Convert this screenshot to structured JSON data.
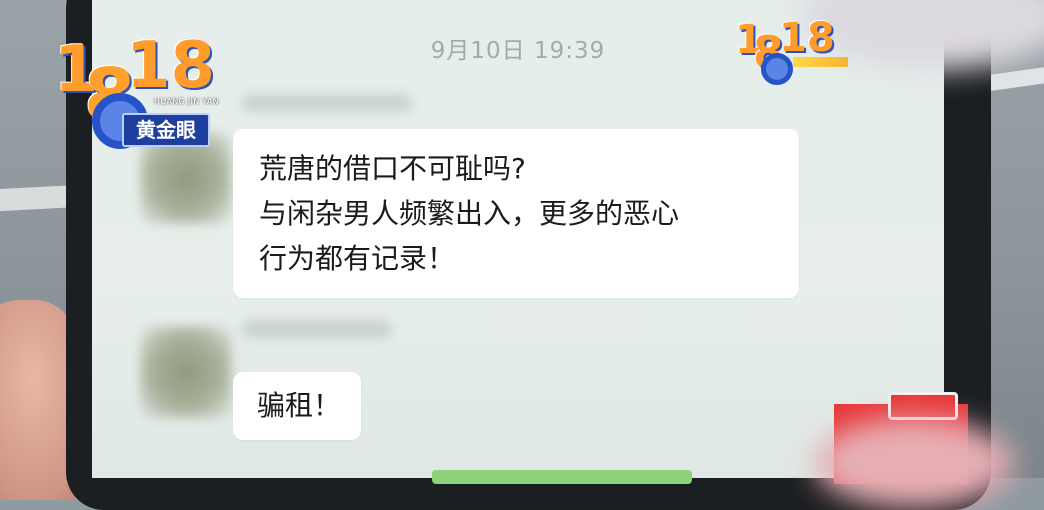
{
  "chat": {
    "timestamp": "9月10日 19:39",
    "messages": [
      {
        "lines": [
          "荒唐的借口不可耻吗?",
          "与闲杂男人频繁出入，更多的恶心",
          "行为都有记录！"
        ]
      },
      {
        "lines": [
          "骗租！"
        ]
      }
    ]
  },
  "logo": {
    "digits": "1818",
    "pinyin": "HUANG JIN YAN",
    "name": "黄金眼"
  },
  "colors": {
    "screen_bg": "#e5eeeb",
    "bubble_bg": "#ffffff",
    "timestamp": "#a4aaa7",
    "logo_orange": "#ff9c2b",
    "logo_blue": "#2753c8"
  }
}
